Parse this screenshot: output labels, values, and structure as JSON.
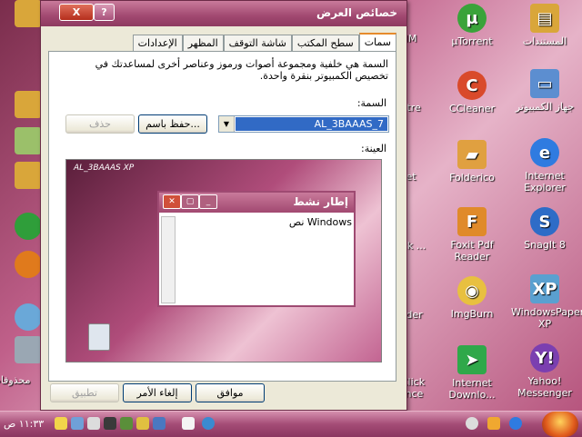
{
  "desktop": {
    "icons": [
      {
        "label": "المستندات",
        "icon": "documents-folder-icon",
        "color": "#d9a63a"
      },
      {
        "label": "µTorrent",
        "icon": "utorrent-icon",
        "color": "#3aa33a"
      },
      {
        "label": "IM",
        "icon": "im-icon",
        "color": "#3b7bd9"
      },
      {
        "label": "جهاز الكمبيوتر",
        "icon": "my-computer-icon",
        "color": "#5c8ed0"
      },
      {
        "label": "CCleaner",
        "icon": "ccleaner-icon",
        "color": "#d94a2b"
      },
      {
        "label": "iltre",
        "icon": "filter-icon",
        "color": "#8a8a8a"
      },
      {
        "label": "Internet Explorer",
        "icon": "internet-explorer-icon",
        "color": "#2f7be0"
      },
      {
        "label": "Folderico",
        "icon": "folderico-icon",
        "color": "#e0a040"
      },
      {
        "label": "et",
        "icon": "app-icon",
        "color": "#8a8a8a"
      },
      {
        "label": "SnagIt 8",
        "icon": "snagit-icon",
        "color": "#2e6cc7"
      },
      {
        "label": "Foxit Pdf Reader",
        "icon": "foxit-reader-icon",
        "color": "#e08a2a"
      },
      {
        "label": "lick ...",
        "icon": "app-icon",
        "color": "#8a8a8a"
      },
      {
        "label": "WindowsPaper XP",
        "icon": "windowspaper-icon",
        "color": "#5aa0d0"
      },
      {
        "label": "ImgBurn",
        "icon": "imgburn-icon",
        "color": "#e8c040"
      },
      {
        "label": "nder",
        "icon": "app-icon",
        "color": "#8a8a8a"
      },
      {
        "label": "Yahoo! Messenger",
        "icon": "yahoo-messenger-icon",
        "color": "#7b3fb0"
      },
      {
        "label": "Internet Downlo...",
        "icon": "internet-download-manager-icon",
        "color": "#2fa84a"
      },
      {
        "label": "-Click ence",
        "icon": "app-icon",
        "color": "#8a8a8a"
      },
      {
        "label": "محذوفات",
        "icon": "recycle-bin-icon",
        "color": "#9aa7b3"
      }
    ]
  },
  "dialog": {
    "title": "خصائص العرض",
    "close_label": "X",
    "help_label": "?",
    "tabs": [
      "سمات",
      "سطح المكتب",
      "شاشة التوقف",
      "المظهر",
      "الإعدادات"
    ],
    "description": "السمة هي خلفية ومجموعة أصوات ورموز وعناصر أخرى لمساعدتك في تخصيص الكمبيوتر بنقرة واحدة.",
    "theme_label": "السمة:",
    "theme_value": "AL_3BAAAS_7",
    "save_as_label": "حفظ باسم...",
    "delete_label": "حذف",
    "sample_label": "العينة:",
    "preview": {
      "title": "AL_3BAAAS XP",
      "active_window_title": "إطار نشط",
      "window_text": "نص Windows"
    },
    "ok_label": "موافق",
    "cancel_label": "إلغاء الأمر",
    "apply_label": "تطبيق"
  },
  "taskbar": {
    "clock": "١١:٣٣ ص",
    "tray_icons": [
      "clock-icon",
      "volume-icon",
      "network-icon",
      "messenger-icon",
      "printer-icon",
      "usb-icon",
      "shield-icon",
      "antivirus-icon"
    ],
    "quick_launch": [
      "winamp-icon",
      "firefox-icon",
      "internet-explorer-icon"
    ]
  }
}
